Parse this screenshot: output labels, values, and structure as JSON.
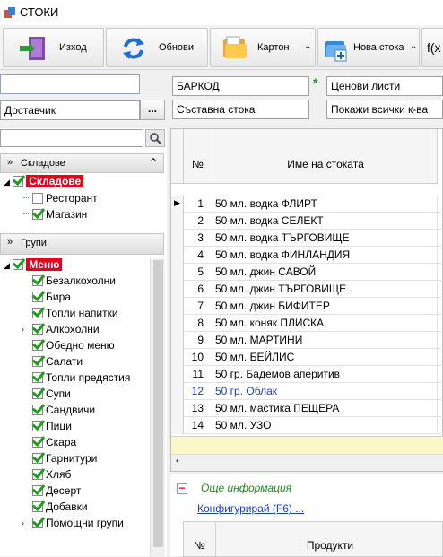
{
  "window": {
    "title": "СТОКИ"
  },
  "toolbar": {
    "exit_label": "Изход",
    "refresh_label": "Обнови",
    "carton_label": "Картон",
    "new_item_label": "Нова стока",
    "fx_label": "f(x"
  },
  "filters": {
    "search_value": "",
    "supplier_value": "Доставчик",
    "barcode_value": "БАРКОД",
    "composite_value": "Съставна стока",
    "required_mark": "*",
    "price_lists_value": "Ценови листи",
    "show_qty_value": "Покажи всички к-ва",
    "browse_label": "..."
  },
  "left": {
    "tree_search_value": "",
    "warehouses_header": "Складове",
    "warehouses_root": "Складове",
    "warehouses": [
      {
        "label": "Ресторант",
        "checked": false
      },
      {
        "label": "Магазин",
        "checked": true
      }
    ],
    "groups_header": "Групи",
    "groups_root": "Меню",
    "groups": [
      {
        "label": "Безалкохолни",
        "expandable": false
      },
      {
        "label": "Бира",
        "expandable": false
      },
      {
        "label": "Топли напитки",
        "expandable": false
      },
      {
        "label": "Алкохолни",
        "expandable": true
      },
      {
        "label": "Обедно меню",
        "expandable": false
      },
      {
        "label": "Салати",
        "expandable": false
      },
      {
        "label": "Топли предястия",
        "expandable": false
      },
      {
        "label": "Супи",
        "expandable": false
      },
      {
        "label": "Сандвичи",
        "expandable": false
      },
      {
        "label": "Пици",
        "expandable": false
      },
      {
        "label": "Скара",
        "expandable": false
      },
      {
        "label": "Гарнитури",
        "expandable": false
      },
      {
        "label": "Хляб",
        "expandable": false
      },
      {
        "label": "Десерт",
        "expandable": false
      },
      {
        "label": "Добавки",
        "expandable": false
      },
      {
        "label": "Помощни групи",
        "expandable": true
      }
    ]
  },
  "grid": {
    "col_no": "№",
    "col_name": "Име на стоката",
    "rows": [
      {
        "no": "1",
        "name": "50 мл. водка ФЛИРТ",
        "current": true
      },
      {
        "no": "2",
        "name": "50 мл. водка СЕЛЕКТ"
      },
      {
        "no": "3",
        "name": "50 мл. водка ТЪРГОВИЩЕ"
      },
      {
        "no": "4",
        "name": "50 мл. водка ФИНЛАНДИЯ"
      },
      {
        "no": "5",
        "name": "50 мл. джин САВОЙ"
      },
      {
        "no": "6",
        "name": "50 мл. джин ТЪРГОВИЩЕ"
      },
      {
        "no": "7",
        "name": "50 мл. джин БИФИТЕР"
      },
      {
        "no": "8",
        "name": "50 мл. коняк ПЛИСКА"
      },
      {
        "no": "9",
        "name": "50 мл. МАРТИНИ"
      },
      {
        "no": "10",
        "name": "50 мл. БЕЙЛИС"
      },
      {
        "no": "11",
        "name": "50 гр. Бадемов аперитив"
      },
      {
        "no": "12",
        "name": "50 гр. Облак",
        "blue": true
      },
      {
        "no": "13",
        "name": "50 мл. мастика ПЕЩЕРА"
      },
      {
        "no": "14",
        "name": "50 мл. УЗО"
      }
    ]
  },
  "bottom": {
    "collapse_label": "−",
    "more_info": "Още информация",
    "configure_link": "Конфигурирай (F6) ...",
    "col_no": "№",
    "col_products": "Продукти"
  },
  "colors": {
    "accent_red": "#e8001c",
    "check_green": "#1e9c1e",
    "link_blue": "#1a3ccc",
    "total_row": "#fbf7c8"
  }
}
